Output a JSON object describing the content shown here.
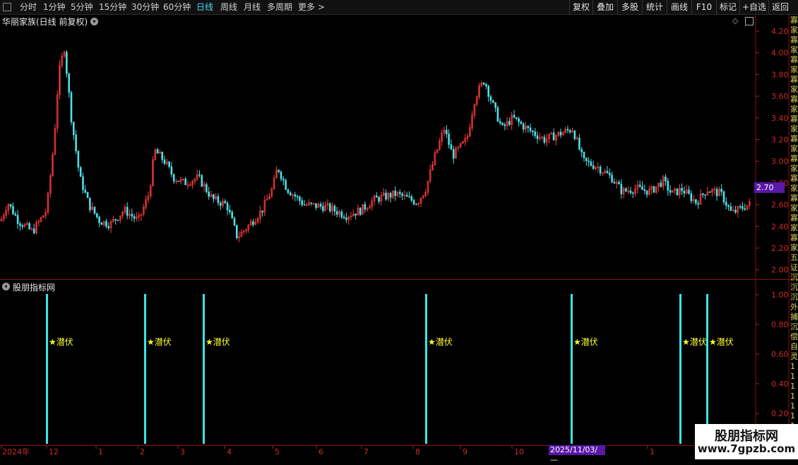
{
  "toolbar": {
    "periods": [
      "分时",
      "1分钟",
      "5分钟",
      "15分钟",
      "30分钟",
      "60分钟",
      "日线",
      "周线",
      "月线",
      "多周期",
      "更多 >"
    ],
    "active_period": "日线",
    "right_buttons": [
      "复权",
      "叠加",
      "多股",
      "统计",
      "画线",
      "F10",
      "标记",
      "+自选",
      "返回"
    ]
  },
  "main_chart": {
    "title": "华丽家族(日线 前复权)",
    "y_ticks": [
      "4.20",
      "4.00",
      "3.80",
      "3.60",
      "3.40",
      "3.20",
      "3.00",
      "2.80",
      "2.60",
      "2.40",
      "2.20",
      "2.00"
    ],
    "current_price": "2.70",
    "colors": {
      "up": "#ff3c3c",
      "down": "#4fe0e8",
      "background": "#000000",
      "grid": "#7a1010"
    }
  },
  "indicator_panel": {
    "title": "股朋指标网",
    "y_ticks": [
      "1.00",
      "0.80",
      "0.60",
      "0.40",
      "0.20"
    ],
    "signal_label": "★潜伏",
    "signal_count": 7
  },
  "x_axis": {
    "labels": [
      "2024年",
      "12",
      "1",
      "2",
      "3",
      "4",
      "5",
      "6",
      "7",
      "8",
      "9",
      "10",
      "2025/11/03/—",
      "1"
    ]
  },
  "watermark": {
    "line1": "股朋指标网",
    "line2": "www.7gpzb.com"
  },
  "right_edge_text": "寡家寡家寡家寡家寡家寡家寡家寡家寡家寡家寡家寡家 五证沉沉沉外捕沉偿 自灵1111111"
}
